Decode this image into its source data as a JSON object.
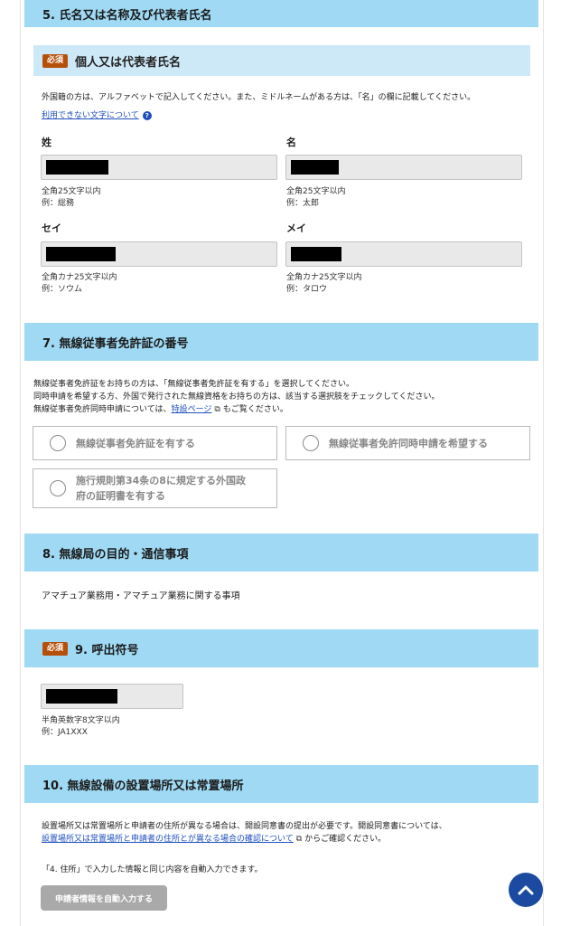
{
  "section5": {
    "title": "5. 氏名又は名称及び代表者氏名",
    "sub": {
      "badge": "必須",
      "title": "個人又は代表者氏名"
    },
    "note": "外国籍の方は、アルファベットで記入してください。また、ミドルネームがある方は、「名」の欄に記載してください。",
    "link": "利用できない文字について",
    "fields": {
      "sei": {
        "label": "姓",
        "hint1": "全角25文字以内",
        "hint2": "例：総務"
      },
      "mei": {
        "label": "名",
        "hint1": "全角25文字以内",
        "hint2": "例：太郎"
      },
      "sei_kana": {
        "label": "セイ",
        "hint1": "全角カナ25文字以内",
        "hint2": "例：ソウム"
      },
      "mei_kana": {
        "label": "メイ",
        "hint1": "全角カナ25文字以内",
        "hint2": "例：タロウ"
      }
    }
  },
  "section7": {
    "title": "7. 無線従事者免許証の番号",
    "line1": "無線従事者免許証をお持ちの方は、「無線従事者免許証を有する」を選択してください。",
    "line2": "同時申請を希望する方、外国で発行された無線資格をお持ちの方は、該当する選択肢をチェックしてください。",
    "line3_pre": "無線従事者免許同時申請については、",
    "line3_link": "特設ページ",
    "line3_post": "もご覧ください。",
    "options": {
      "a": "無線従事者免許証を有する",
      "b": "無線従事者免許同時申請を希望する",
      "c1": "施行規則第34条の8に規定する外国政",
      "c2": "府の証明書を有する"
    }
  },
  "section8": {
    "title": "8. 無線局の目的・通信事項",
    "value": "アマチュア業務用・アマチュア業務に関する事項"
  },
  "section9": {
    "badge": "必須",
    "title": "9. 呼出符号",
    "hint1": "半角英数字8文字以内",
    "hint2": "例：JA1XXX"
  },
  "section10": {
    "title": "10. 無線設備の設置場所又は常置場所",
    "line1": "設置場所又は常置場所と申請者の住所が異なる場合は、開設同意書の提出が必要です。開設同意書については、",
    "line2_link": "設置場所又は常置場所と申請者の住所とが異なる場合の確認について",
    "line2_post": "からご確認ください。",
    "line3": "「4. 住所」で入力した情報と同じ内容を自動入力できます。",
    "button": "申請者情報を自動入力する"
  }
}
